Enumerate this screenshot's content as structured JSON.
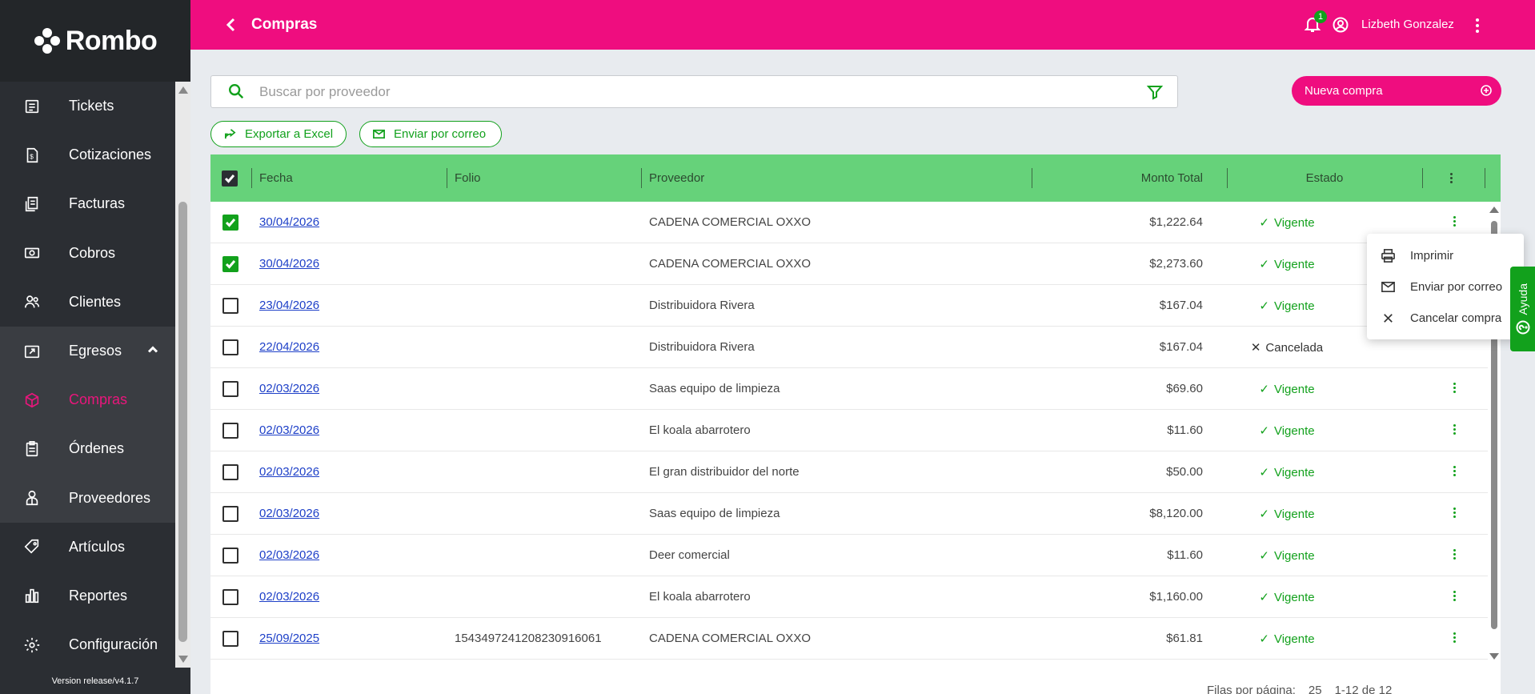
{
  "app": {
    "brand": "Rombo",
    "version": "Version release/v4.1.7"
  },
  "sidebar": {
    "items": [
      {
        "label": "Tickets",
        "icon": "ticket-icon"
      },
      {
        "label": "Cotizaciones",
        "icon": "quote-icon"
      },
      {
        "label": "Facturas",
        "icon": "invoice-icon"
      },
      {
        "label": "Cobros",
        "icon": "cash-icon"
      },
      {
        "label": "Clientes",
        "icon": "clients-icon"
      },
      {
        "label": "Egresos",
        "icon": "expenses-icon",
        "expanded": true
      },
      {
        "label": "Compras",
        "icon": "cube-icon",
        "active": true
      },
      {
        "label": "Órdenes",
        "icon": "orders-icon"
      },
      {
        "label": "Proveedores",
        "icon": "supplier-icon"
      },
      {
        "label": "Artículos",
        "icon": "tag-icon"
      },
      {
        "label": "Reportes",
        "icon": "chart-icon"
      },
      {
        "label": "Configuración",
        "icon": "gear-icon"
      }
    ]
  },
  "header": {
    "title": "Compras",
    "notifications": "1",
    "user": "Lizbeth Gonzalez"
  },
  "search": {
    "placeholder": "Buscar por proveedor",
    "value": ""
  },
  "actions": {
    "new_purchase": "Nueva compra",
    "export_excel": "Exportar a Excel",
    "send_mail": "Enviar por correo"
  },
  "table": {
    "columns": {
      "fecha": "Fecha",
      "folio": "Folio",
      "proveedor": "Proveedor",
      "monto": "Monto Total",
      "estado": "Estado"
    },
    "rows": [
      {
        "checked": true,
        "fecha": "30/04/2026",
        "folio": "",
        "proveedor": "CADENA COMERCIAL OXXO",
        "monto": "$1,222.64",
        "estado": "Vigente"
      },
      {
        "checked": true,
        "fecha": "30/04/2026",
        "folio": "",
        "proveedor": "CADENA COMERCIAL OXXO",
        "monto": "$2,273.60",
        "estado": "Vigente"
      },
      {
        "checked": false,
        "fecha": "23/04/2026",
        "folio": "",
        "proveedor": "Distribuidora Rivera",
        "monto": "$167.04",
        "estado": "Vigente"
      },
      {
        "checked": false,
        "fecha": "22/04/2026",
        "folio": "",
        "proveedor": "Distribuidora Rivera",
        "monto": "$167.04",
        "estado": "Cancelada"
      },
      {
        "checked": false,
        "fecha": "02/03/2026",
        "folio": "",
        "proveedor": "Saas equipo de limpieza",
        "monto": "$69.60",
        "estado": "Vigente"
      },
      {
        "checked": false,
        "fecha": "02/03/2026",
        "folio": "",
        "proveedor": "El koala abarrotero",
        "monto": "$11.60",
        "estado": "Vigente"
      },
      {
        "checked": false,
        "fecha": "02/03/2026",
        "folio": "",
        "proveedor": "El gran distribuidor del norte",
        "monto": "$50.00",
        "estado": "Vigente"
      },
      {
        "checked": false,
        "fecha": "02/03/2026",
        "folio": "",
        "proveedor": "Saas equipo de limpieza",
        "monto": "$8,120.00",
        "estado": "Vigente"
      },
      {
        "checked": false,
        "fecha": "02/03/2026",
        "folio": "",
        "proveedor": "Deer comercial",
        "monto": "$11.60",
        "estado": "Vigente"
      },
      {
        "checked": false,
        "fecha": "02/03/2026",
        "folio": "",
        "proveedor": "El koala abarrotero",
        "monto": "$1,160.00",
        "estado": "Vigente"
      },
      {
        "checked": false,
        "fecha": "25/09/2025",
        "folio": "1543497241208230916061",
        "proveedor": "CADENA COMERCIAL OXXO",
        "monto": "$61.81",
        "estado": "Vigente"
      }
    ],
    "footer": {
      "rows_per_page_label": "Filas por página:",
      "rows_per_page": "25",
      "range": "1-12 de 12"
    }
  },
  "context_menu": {
    "items": [
      {
        "label": "Imprimir",
        "icon": "printer-icon"
      },
      {
        "label": "Enviar por correo",
        "icon": "mail-icon"
      },
      {
        "label": "Cancelar compra",
        "icon": "close-icon"
      }
    ]
  },
  "help": {
    "label": "Ayuda"
  },
  "colors": {
    "brand_pink": "#ef0d7f",
    "accent_green": "#12a11c",
    "header_green": "#66d27a",
    "sidebar": "#2b2e33"
  }
}
